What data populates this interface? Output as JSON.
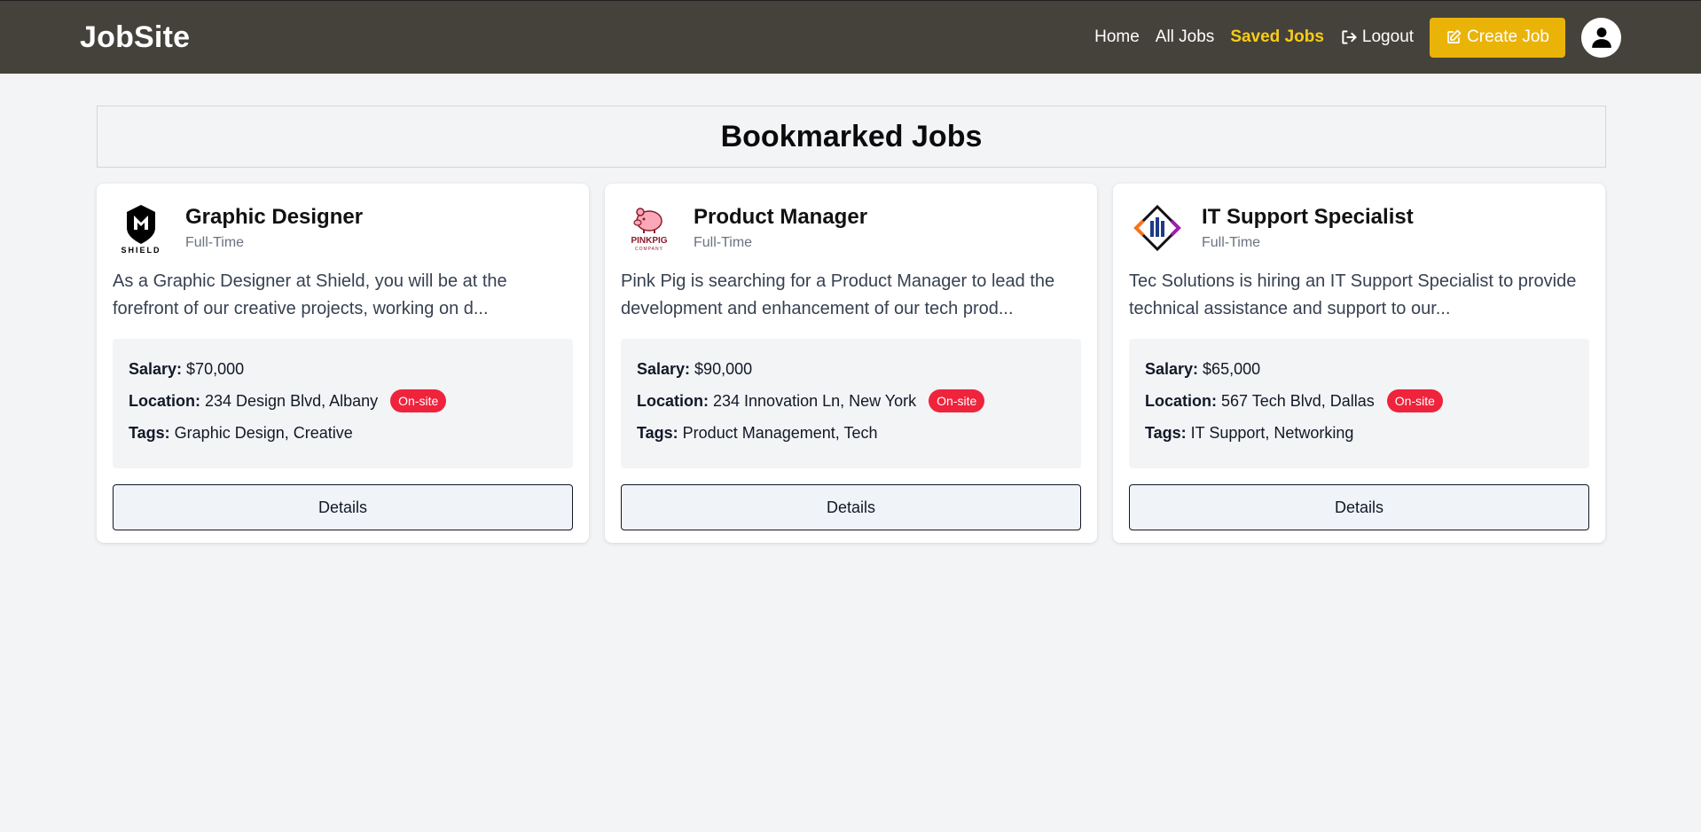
{
  "nav": {
    "brand": "JobSite",
    "links": [
      "Home",
      "All Jobs",
      "Saved Jobs",
      "Logout"
    ],
    "create_label": "Create Job",
    "active_color": "#facc15",
    "bg_color": "#45423b"
  },
  "page": {
    "title": "Bookmarked Jobs"
  },
  "jobs": [
    {
      "title": "Graphic Designer",
      "type": "Full-Time",
      "logo_text": "SHIELD",
      "description": "As a Graphic Designer at Shield, you will be at the forefront of our creative projects, working on d...",
      "salary_label": "Salary:",
      "salary": "$70,000",
      "location_label": "Location:",
      "location": "234 Design Blvd, Albany",
      "badge": "On-site",
      "tags_label": "Tags:",
      "tags": "Graphic Design, Creative",
      "button": "Details"
    },
    {
      "title": "Product Manager",
      "type": "Full-Time",
      "logo_text": "PINKPIG",
      "logo_sub": "COMPANY",
      "description": "Pink Pig is searching for a Product Manager to lead the development and enhancement of our tech prod...",
      "salary_label": "Salary:",
      "salary": "$90,000",
      "location_label": "Location:",
      "location": "234 Innovation Ln, New York",
      "badge": "On-site",
      "tags_label": "Tags:",
      "tags": "Product Management, Tech",
      "button": "Details"
    },
    {
      "title": "IT Support Specialist",
      "type": "Full-Time",
      "description": "Tec Solutions is hiring an IT Support Specialist to provide technical assistance and support to our...",
      "salary_label": "Salary:",
      "salary": "$65,000",
      "location_label": "Location:",
      "location": "567 Tech Blvd, Dallas",
      "badge": "On-site",
      "tags_label": "Tags:",
      "tags": "IT Support, Networking",
      "button": "Details"
    }
  ],
  "colors": {
    "badge": "#ef233c",
    "create_button": "#eab308"
  }
}
